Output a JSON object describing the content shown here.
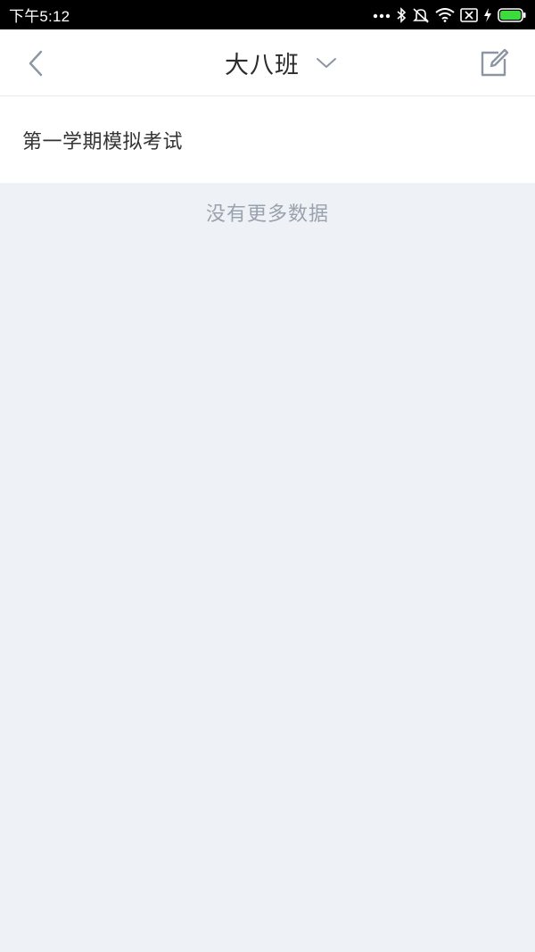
{
  "status_bar": {
    "time": "下午5:12",
    "icons": [
      "more-dots-icon",
      "bluetooth-icon",
      "mute-icon",
      "wifi-icon",
      "sim-blocked-icon",
      "charging-icon",
      "battery-icon"
    ]
  },
  "nav": {
    "title": "大八班",
    "back_icon": "chevron-left-icon",
    "dropdown_icon": "chevron-down-icon",
    "edit_icon": "edit-icon"
  },
  "list": {
    "items": [
      {
        "label": "第一学期模拟考试"
      }
    ]
  },
  "empty_note": "没有更多数据",
  "colors": {
    "status_bar_bg": "#000000",
    "nav_bg": "#ffffff",
    "page_bg": "#eef1f5",
    "icon_gray": "#8c96a3",
    "battery_green": "#3ddc3d"
  }
}
